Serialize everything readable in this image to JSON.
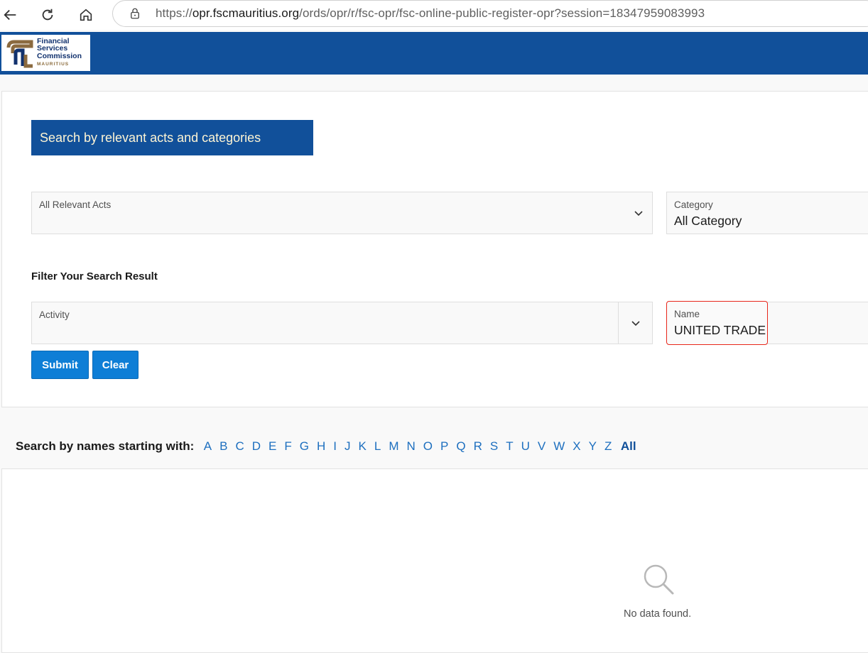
{
  "browser": {
    "url_host": "opr.fscmauritius.org",
    "url_path": "/ords/opr/r/fsc-opr/fsc-online-public-register-opr?session=18347959083993",
    "url_scheme": "https://"
  },
  "brand": {
    "line1": "Financial",
    "line2": "Services",
    "line3": "Commission",
    "sub": "MAURITIUS",
    "header_color": "#11509a"
  },
  "search": {
    "section_title": "Search by relevant acts and categories",
    "acts_field": {
      "label": "All Relevant Acts",
      "value": ""
    },
    "category_field": {
      "label": "Category",
      "value": "All Category"
    },
    "filter_heading": "Filter Your Search Result",
    "activity_field": {
      "label": "Activity",
      "value": ""
    },
    "name_field": {
      "label": "Name",
      "value": "UNITED TRADE"
    },
    "submit_label": "Submit",
    "clear_label": "Clear"
  },
  "alphabet": {
    "label": "Search by names starting with:",
    "letters": [
      "A",
      "B",
      "C",
      "D",
      "E",
      "F",
      "G",
      "H",
      "I",
      "J",
      "K",
      "L",
      "M",
      "N",
      "O",
      "P",
      "Q",
      "R",
      "S",
      "T",
      "U",
      "V",
      "W",
      "X",
      "Y",
      "Z"
    ],
    "all_label": "All"
  },
  "results": {
    "empty_text": "No data found.",
    "empty_icon": "search-icon"
  }
}
